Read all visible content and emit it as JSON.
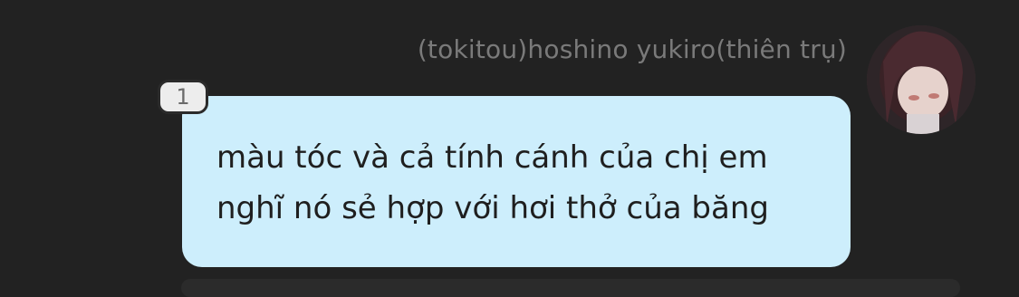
{
  "message": {
    "sender_name": "(tokitou)hoshino yukiro(thiên trụ)",
    "text": "màu tóc và cả tính cánh của chị em\nnghĩ nó sẻ hợp với hơi thở của băng",
    "reaction_count": "1"
  },
  "colors": {
    "background": "#222222",
    "bubble": "#cdeefc",
    "sender_name": "#7a7a7a",
    "badge": "#ededed"
  }
}
